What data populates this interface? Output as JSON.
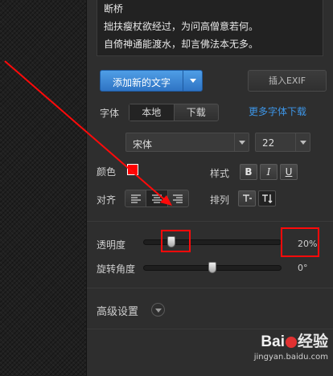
{
  "text_preview": {
    "lines": [
      "断桥",
      "拙扶瘦杖欲经过，为问高僧意若何。",
      "自倚神通能渡水，却言佛法本无多。"
    ]
  },
  "buttons": {
    "add_text": "添加新的文字",
    "insert_exif": "插入EXIF"
  },
  "font": {
    "label": "字体",
    "source_options": [
      "本地",
      "下载"
    ],
    "active_source": "本地",
    "more_fonts_link": "更多字体下载",
    "family": "宋体",
    "size": "22"
  },
  "color": {
    "label": "颜色",
    "value": "#ff0000"
  },
  "style": {
    "label": "样式",
    "buttons": [
      "B",
      "I",
      "U"
    ]
  },
  "align": {
    "label": "对齐",
    "options": [
      "align-left",
      "align-center",
      "align-right"
    ],
    "active": "align-center"
  },
  "arrange": {
    "label": "排列",
    "options": [
      "horizontal-text",
      "vertical-text"
    ],
    "active": "vertical-text"
  },
  "opacity": {
    "label": "透明度",
    "value_text": "20%",
    "fraction": 0.2
  },
  "rotation": {
    "label": "旋转角度",
    "value_text": "0°",
    "fraction": 0.5
  },
  "advanced": {
    "label": "高级设置"
  },
  "watermark": {
    "brand_left": "Bai",
    "brand_right": "经验",
    "url": "jingyan.baidu.com"
  },
  "colors": {
    "accent_blue": "#3d96e8",
    "annotation_red": "#ff0a0a",
    "panel_bg": "#2e2e2e"
  }
}
